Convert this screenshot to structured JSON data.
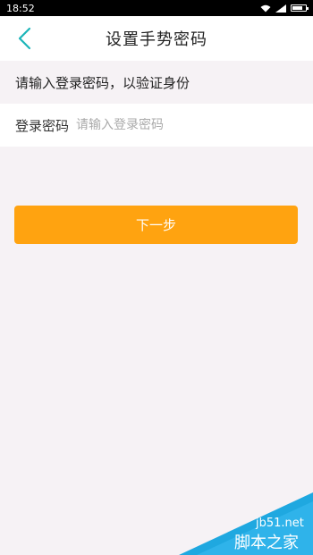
{
  "status_bar": {
    "time": "18:52",
    "icons": [
      "wifi-icon",
      "signal-icon",
      "battery-icon"
    ]
  },
  "header": {
    "title": "设置手势密码",
    "back_icon": "chevron-left-icon"
  },
  "notice": {
    "text": "请输入登录密码，以验证身份"
  },
  "password_field": {
    "label": "登录密码",
    "placeholder": "请输入登录密码",
    "value": ""
  },
  "next_button": {
    "label": "下一步"
  },
  "watermark": {
    "site": "jb51.net",
    "brand": "脚本之家"
  },
  "colors": {
    "accent": "#ffa310",
    "back_arrow": "#1bb5b9",
    "background": "#f6f2f5",
    "watermark": "#1fa8e0"
  }
}
